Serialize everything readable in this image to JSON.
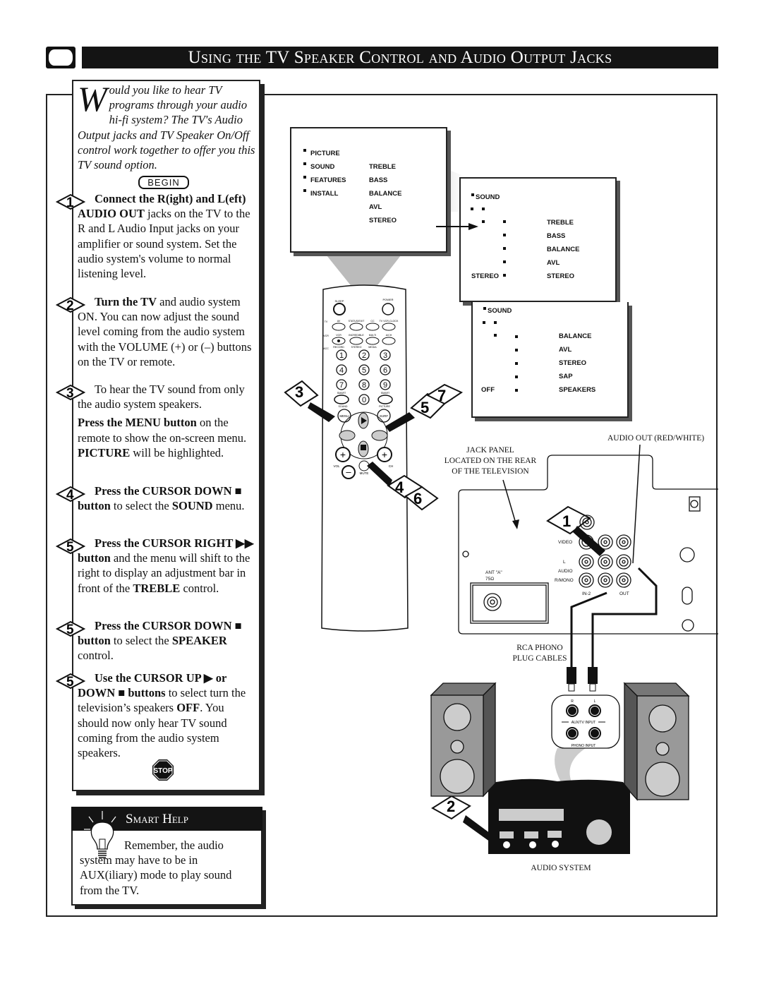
{
  "header": {
    "title": "Using the TV Speaker Control and Audio Output Jacks"
  },
  "intro": {
    "dropcap": "W",
    "text": "ould you like to hear TV programs through your audio hi-fi system? The TV's Audio Output jacks and TV Speaker On/Off control work together to offer you this TV sound option."
  },
  "begin_label": "BEGIN",
  "steps": [
    {
      "num": "1",
      "paras": [
        [
          {
            "b": true,
            "t": "Connect the R(ight) and L(eft) AUDIO OUT"
          },
          {
            "t": " jacks on the TV to the R and L Audio Input jacks on your amplifier or sound system. Set the audio system's volume to normal listening level."
          }
        ]
      ]
    },
    {
      "num": "2",
      "paras": [
        [
          {
            "b": true,
            "t": "Turn the TV"
          },
          {
            "t": " and audio system ON. You can now adjust the sound level coming from the audio system with the VOLUME (+) or (–) buttons on the TV or remote."
          }
        ]
      ]
    },
    {
      "num": "3",
      "paras": [
        [
          {
            "t": "To hear the TV sound from only the audio system speakers."
          }
        ],
        [
          {
            "b": true,
            "t": "Press the MENU button"
          },
          {
            "t": " on the remote to show the on-screen menu. "
          },
          {
            "b": true,
            "t": "PICTURE"
          },
          {
            "t": " will be highlighted."
          }
        ]
      ]
    },
    {
      "num": "4",
      "paras": [
        [
          {
            "b": true,
            "t": "Press the CURSOR DOWN ■ button"
          },
          {
            "t": " to select the "
          },
          {
            "b": true,
            "t": "SOUND"
          },
          {
            "t": " menu."
          }
        ]
      ]
    },
    {
      "num": "5",
      "paras": [
        [
          {
            "b": true,
            "t": "Press the CURSOR RIGHT ▶▶ button"
          },
          {
            "t": " and the menu will shift to the right to display an adjustment bar in front of the "
          },
          {
            "b": true,
            "t": "TREBLE"
          },
          {
            "t": " control."
          }
        ]
      ]
    },
    {
      "num": "5",
      "paras": [
        [
          {
            "b": true,
            "t": "Press the CURSOR DOWN ■ button"
          },
          {
            "t": " to select the "
          },
          {
            "b": true,
            "t": "SPEAKER"
          },
          {
            "t": " control."
          }
        ]
      ]
    },
    {
      "num": "5",
      "paras": [
        [
          {
            "b": true,
            "t": "Use the CURSOR UP ▶ or DOWN ■ buttons"
          },
          {
            "t": " to select turn the television’s speakers "
          },
          {
            "b": true,
            "t": "OFF"
          },
          {
            "t": ". You should now only hear TV sound coming from the audio system speakers."
          }
        ]
      ]
    }
  ],
  "stop_label": "STOP",
  "smart_help": {
    "title": "Smart Help",
    "text": "Remember, the audio system may have to be in AUX(iliary) mode to play sound from the TV."
  },
  "menus": {
    "main": {
      "left": [
        "PICTURE",
        "SOUND",
        "FEATURES",
        "INSTALL"
      ],
      "right": [
        "TREBLE",
        "BASS",
        "BALANCE",
        "AVL",
        "STEREO"
      ]
    },
    "sound1": {
      "title": "SOUND",
      "items": [
        "TREBLE",
        "BASS",
        "BALANCE",
        "AVL",
        "STEREO"
      ],
      "value": "STEREO"
    },
    "sound2": {
      "title": "SOUND",
      "items": [
        "BALANCE",
        "AVL",
        "STEREO",
        "SAP",
        "SPEAKERS"
      ],
      "value": "OFF"
    }
  },
  "remote": {
    "sleep": "SLEEP",
    "power": "POWER",
    "row1": [
      "AV",
      "STATUS/EXIT",
      "CC",
      "TV VCR-CLOCK"
    ],
    "row2": [
      "VCR",
      "INCREDIBLE",
      "MULTI",
      "A/CH"
    ],
    "row2_sub": [
      "RECORD",
      "STEREO",
      "MEDIA"
    ],
    "modes": [
      "TV",
      "VCR",
      "ACC"
    ],
    "digits": [
      "1",
      "2",
      "3",
      "4",
      "5",
      "6",
      "7",
      "8",
      "9",
      "0"
    ],
    "smart": "SMART",
    "sound": "SOUND",
    "picture": "PICTURE",
    "menu": "MENU",
    "surf": "SURF",
    "vol": "VOL",
    "ch": "CH",
    "mute": "MUTE"
  },
  "callouts": [
    "3",
    "5",
    "7",
    "4",
    "6",
    "1",
    "2"
  ],
  "labels": {
    "audio_out": "AUDIO OUT (RED/WHITE)",
    "jack_panel": "JACK PANEL\nLOCATED ON THE REAR\nOF THE TELEVISION",
    "rca": "RCA PHONO\nPLUG CABLES",
    "audio_system": "AUDIO SYSTEM",
    "video": "VIDEO",
    "l": "L",
    "audio": "AUDIO",
    "rmono": "R/MONO",
    "in2": "IN-2",
    "out": "OUT",
    "ant": "ANT \"A\"",
    "ohm": "75Ω",
    "aux_input": "AUX/TV INPUT",
    "phono_input": "PHONO INPUT",
    "r": "R",
    "l2": "L"
  }
}
